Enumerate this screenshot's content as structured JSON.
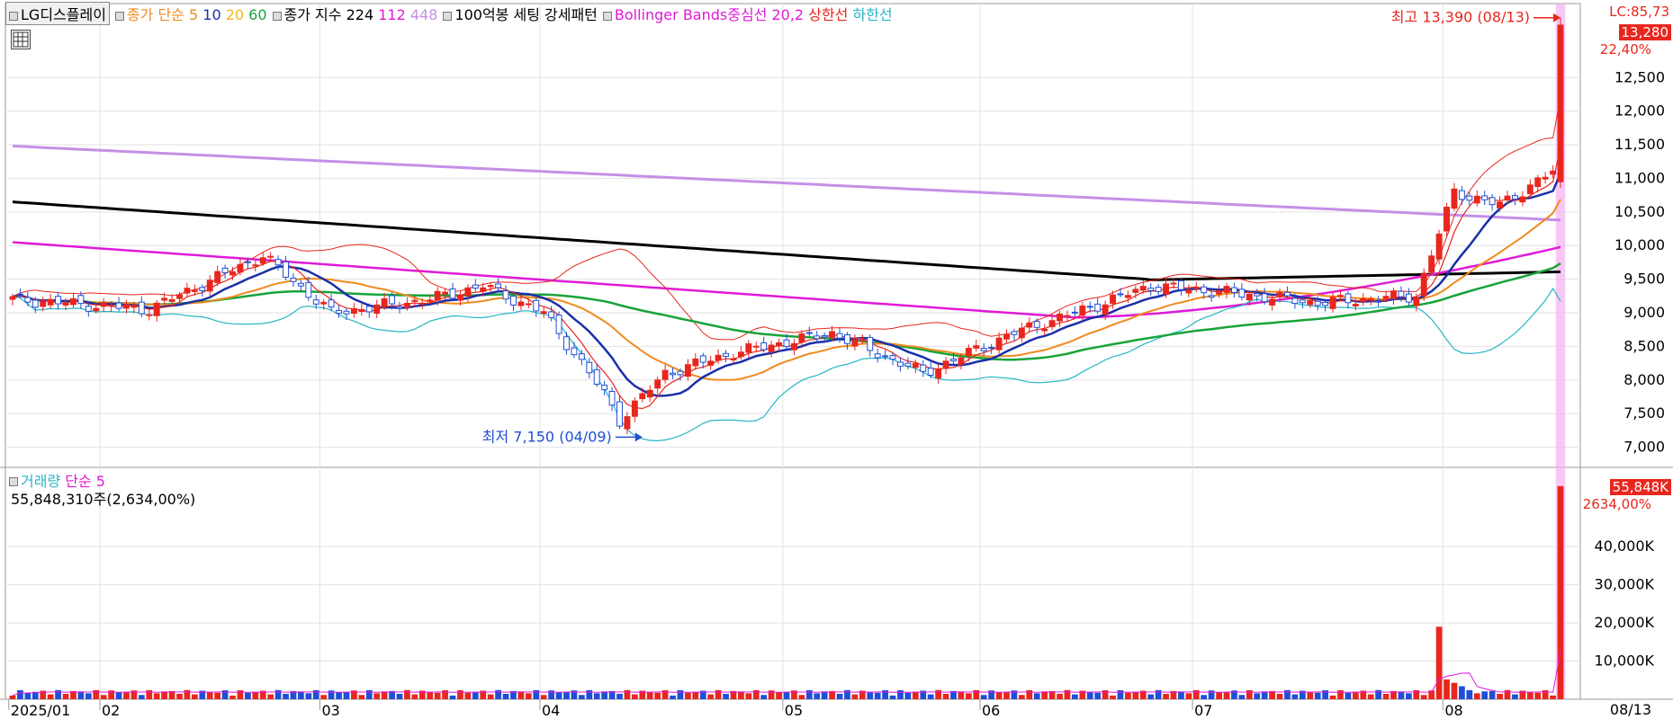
{
  "legend": {
    "stock_name": "LG디스플레이",
    "ma_label": "종가 단순",
    "ma5": "5",
    "ma10": "10",
    "ma20": "20",
    "ma60": "60",
    "idx_label": "종가 지수",
    "idx224": "224",
    "idx112": "112",
    "idx448": "448",
    "pattern_label": "100억봉 세팅 강세패턴",
    "bb_label": "Bollinger Bands중심선 20,2",
    "bb_upper": "상한선",
    "bb_lower": "하한선"
  },
  "volume_legend": {
    "label": "거래량",
    "ma_label": "단순 5",
    "info": "55,848,310주(2,634,00%)"
  },
  "right_panel": {
    "corner_label": "LC:85,73",
    "price_tag": "13,280",
    "price_pct": "22,40%",
    "volume_tag": "55,848K",
    "volume_pct": "2634,00%",
    "date_end": "08/13"
  },
  "annotations": {
    "high": "최고 13,390 (08/13)",
    "low": "최저 7,150 (04/09)"
  },
  "colors": {
    "up": "#e8261e",
    "down": "#1f4fd6",
    "ma5": "#e8261e",
    "ma10": "#1a2fa8",
    "ma20": "#f08a1e",
    "ma60": "#19a33b",
    "idx224": "#000000",
    "idx112": "#e01ad7",
    "idx448": "#c58fe8",
    "bb_upper": "#e8261e",
    "bb_lower": "#27b6c4",
    "highlight": "#f5b0ef"
  },
  "chart_data": [
    {
      "type": "candlestick",
      "title": "LG디스플레이",
      "y_axis_ticks": [
        7000,
        7500,
        8000,
        8500,
        9000,
        9500,
        10000,
        10500,
        11000,
        11500,
        12000,
        12500
      ],
      "ylim": [
        6700,
        13600
      ],
      "x_labels": [
        "2025/01",
        "02",
        "03",
        "04",
        "05",
        "06",
        "07",
        "08"
      ],
      "x_label_index": [
        0,
        12,
        41,
        70,
        102,
        128,
        156,
        189
      ],
      "n_days": 205,
      "series": [
        {
          "name": "LG디스플레이",
          "anchor_index": [
            0,
            18,
            33,
            42,
            55,
            62,
            70,
            78,
            80,
            86,
            95,
            108,
            120,
            132,
            140,
            150,
            160,
            172,
            185,
            190,
            196,
            203,
            204
          ],
          "anchor_close": [
            9200,
            9050,
            9850,
            9000,
            9200,
            9400,
            9000,
            7800,
            7400,
            8100,
            8400,
            8700,
            8100,
            8700,
            9000,
            9400,
            9300,
            9150,
            9250,
            10800,
            10600,
            11100,
            13280
          ]
        }
      ],
      "high_annotation": {
        "value": 13390,
        "date": "08/13"
      },
      "low_annotation": {
        "value": 7150,
        "date": "04/09"
      },
      "grid": true
    },
    {
      "type": "bar",
      "title": "거래량",
      "y_axis_ticks": [
        "10,000K",
        "20,000K",
        "30,000K",
        "40,000K"
      ],
      "y_tick_values": [
        10000,
        20000,
        30000,
        40000
      ],
      "ylim": [
        0,
        57000
      ],
      "spikes": [
        {
          "index": 188,
          "value": 19000
        },
        {
          "index": 204,
          "value": 55848
        }
      ],
      "typical_value": 1600,
      "grid": true
    }
  ]
}
